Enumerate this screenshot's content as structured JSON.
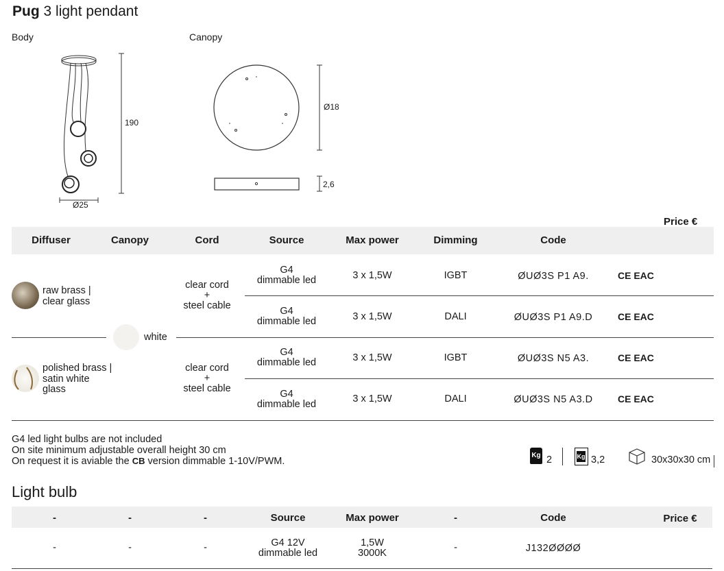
{
  "header": {
    "brand": "Pug",
    "product": "3 light pendant"
  },
  "drawings": {
    "body_label": "Body",
    "canopy_label": "Canopy",
    "body_height": "190",
    "body_diameter": "Ø25",
    "canopy_diameter": "Ø18",
    "canopy_height": "2,6"
  },
  "table": {
    "price_header": "Price €",
    "headers": [
      "Diffuser",
      "Canopy",
      "Cord",
      "Source",
      "Max power",
      "Dimming",
      "Code"
    ],
    "canopy_value": "white",
    "groups": [
      {
        "diffuser": [
          "raw brass |",
          "clear glass"
        ],
        "cord": [
          "clear cord",
          "+",
          "steel cable"
        ],
        "rows": [
          {
            "source": [
              "G4",
              "dimmable led"
            ],
            "power": "3 x 1,5W",
            "dimming": "IGBT",
            "code": "ØUØ3S P1 A9.",
            "cert": "CE EAC"
          },
          {
            "source": [
              "G4",
              "dimmable led"
            ],
            "power": "3 x 1,5W",
            "dimming": "DALI",
            "code": "ØUØ3S P1 A9.D",
            "cert": "CE EAC"
          }
        ]
      },
      {
        "diffuser": [
          "polished brass |",
          "satin white",
          "glass"
        ],
        "cord": [
          "clear cord",
          "+",
          "steel cable"
        ],
        "rows": [
          {
            "source": [
              "G4",
              "dimmable led"
            ],
            "power": "3 x 1,5W",
            "dimming": "IGBT",
            "code": "ØUØ3S N5 A3.",
            "cert": "CE EAC"
          },
          {
            "source": [
              "G4",
              "dimmable led"
            ],
            "power": "3 x 1,5W",
            "dimming": "DALI",
            "code": "ØUØ3S N5 A3.D",
            "cert": "CE EAC"
          }
        ]
      }
    ]
  },
  "notes": {
    "line1": "G4 led light bulbs are not included",
    "line2": "On site minimum adjustable overall height 30 cm",
    "line3_pre": "On request it is aviable the",
    "line3_logo": "CB",
    "line3_post": "version dimmable 1-10V/PWM."
  },
  "shipping": {
    "net_weight": "2",
    "gross_weight": "3,2",
    "box": "30x30x30 cm",
    "kg_label": "Kg"
  },
  "bulb": {
    "title": "Light bulb",
    "headers": [
      "-",
      "-",
      "-",
      "Source",
      "Max power",
      "-",
      "Code",
      "Price €"
    ],
    "row": {
      "c1": "-",
      "c2": "-",
      "c3": "-",
      "source": [
        "G4 12V",
        "dimmable led"
      ],
      "power": [
        "1,5W",
        "3000K"
      ],
      "c6": "-",
      "code": "J132ØØØØ"
    }
  }
}
